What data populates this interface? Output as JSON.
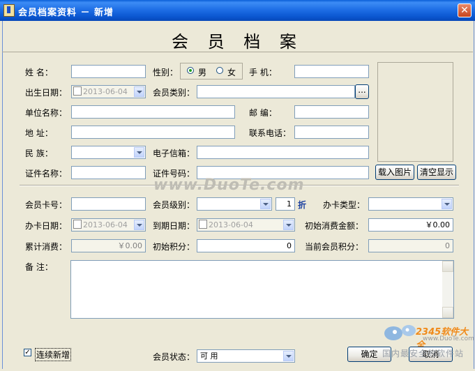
{
  "window": {
    "title": "会员档案资料 － 新增"
  },
  "header": {
    "title": "会 员 档 案"
  },
  "basic": {
    "name_label": "姓    名：",
    "gender_label": "性别：",
    "gender_options": [
      "男",
      "女"
    ],
    "phone_label": "手    机：",
    "birth_label": "出生日期：",
    "birth_value": "2013-06-04",
    "member_type_label": "会员类别：",
    "member_type_btn": "...",
    "company_label": "单位名称：",
    "zip_label": "邮    编：",
    "address_label": "地    址：",
    "contact_phone_label": "联系电话：",
    "ethnic_label": "民    族：",
    "email_label": "电子信箱：",
    "id_name_label": "证件名称：",
    "id_number_label": "证件号码：",
    "load_photo_btn": "载入图片",
    "clear_photo_btn": "清空显示"
  },
  "card": {
    "card_no_label": "会员卡号：",
    "level_label": "会员级别：",
    "discount_value": "1",
    "discount_unit": "折",
    "card_type_label": "办卡类型：",
    "issue_date_label": "办卡日期：",
    "issue_date_value": "2013-06-04",
    "expire_date_label": "到期日期：",
    "expire_date_value": "2013-06-04",
    "initial_amount_label": "初始消费金额：",
    "initial_amount_value": "￥0.00",
    "total_spend_label": "累计消费：",
    "total_spend_value": "￥0.00",
    "initial_points_label": "初始积分：",
    "initial_points_value": "0",
    "current_points_label": "当前会员积分：",
    "current_points_value": "0",
    "remark_label": "备    注："
  },
  "footer": {
    "continue_label": "连续新增",
    "continue_checked": "✓",
    "status_label": "会员状态：",
    "status_value": "可    用",
    "ok_btn": "确定",
    "cancel_btn": "取消"
  },
  "watermark": {
    "site": "www.DuoTe.com",
    "logo_text": "2345软件大全",
    "logo_url": "www.DuoTe.com",
    "logo_cn": "国内最安全的软件站"
  }
}
